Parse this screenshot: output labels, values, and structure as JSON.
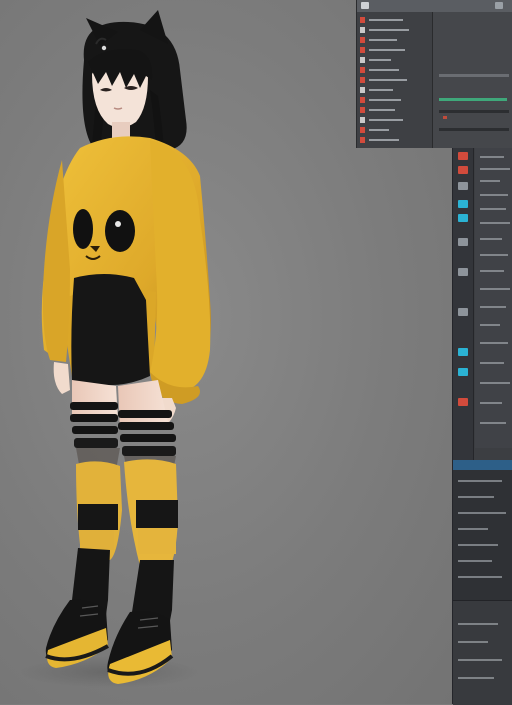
{
  "scene": {
    "subject": "character-3d-model",
    "colors": {
      "background": "#7b7b7b",
      "hoodie": "#e0ae2a",
      "black": "#141414",
      "skin": "#f2dccd"
    }
  },
  "floating_panel": {
    "rows": 13,
    "accent_green": "#3fa87a",
    "accent_red": "#c04b3b"
  },
  "side_dock": {
    "accent_cyan": "#2bb3d4",
    "accent_red": "#d24b3c",
    "tab_blue": "#2d5f88"
  }
}
